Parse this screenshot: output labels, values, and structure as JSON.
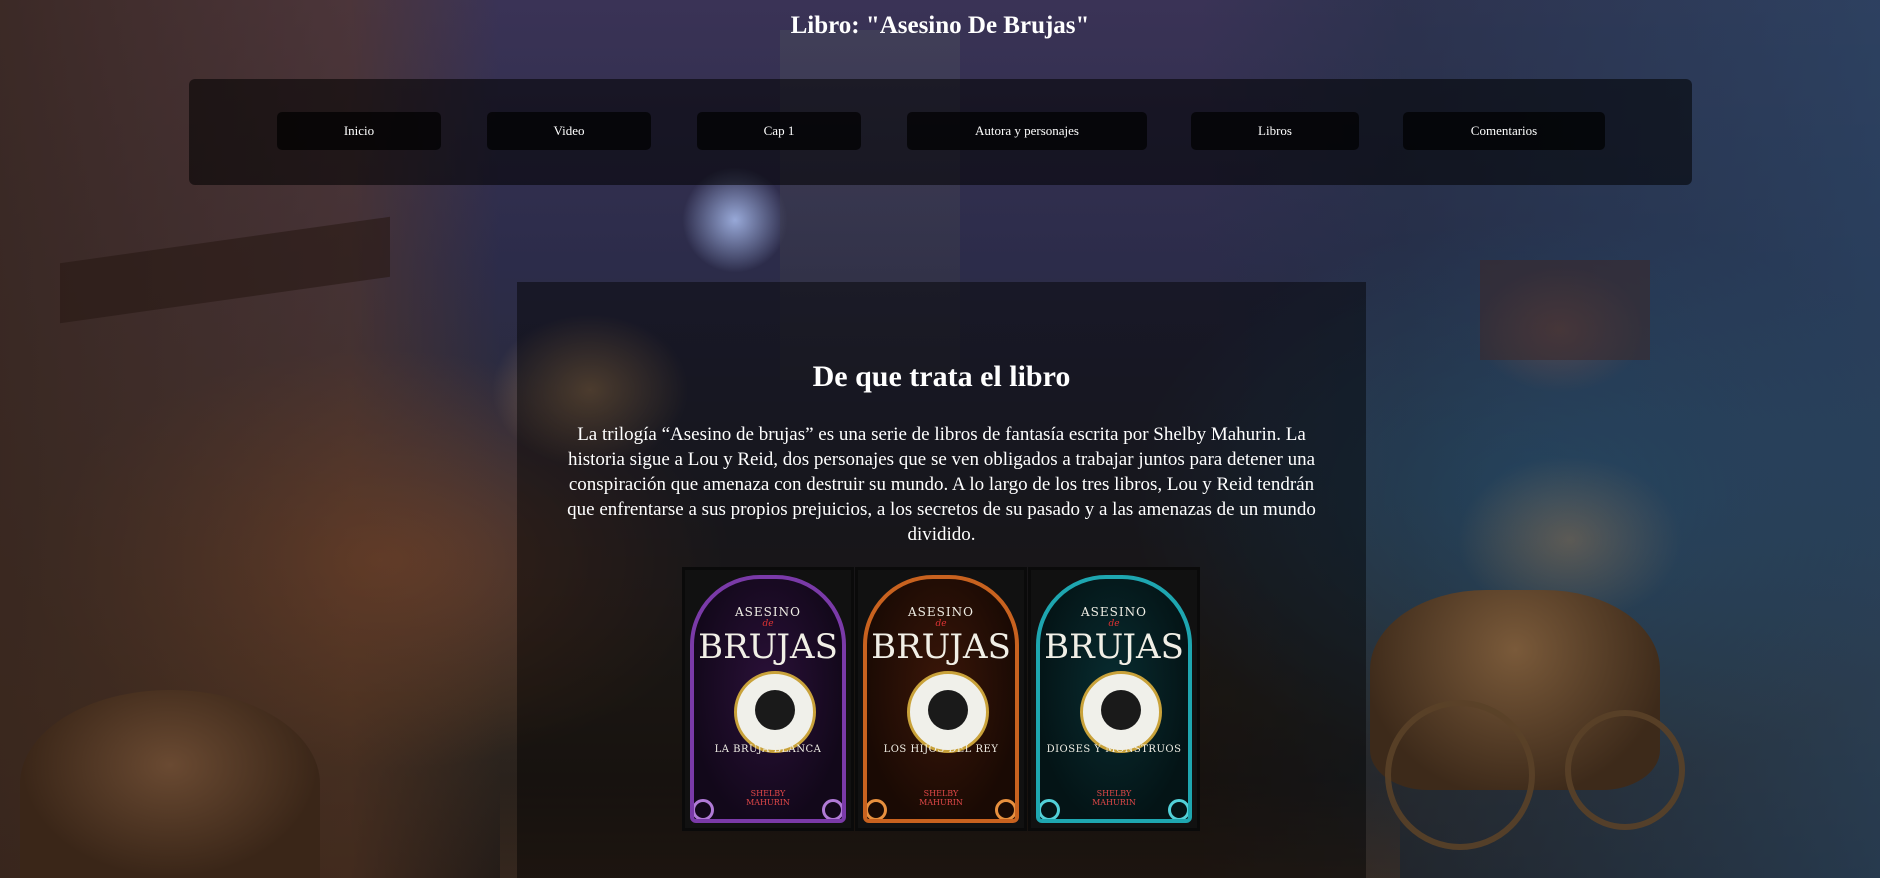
{
  "header": {
    "title": "Libro: \"Asesino De Brujas\""
  },
  "nav": {
    "items": [
      {
        "label": "Inicio"
      },
      {
        "label": "Video"
      },
      {
        "label": "Cap 1"
      },
      {
        "label": "Autora y personajes"
      },
      {
        "label": "Libros"
      },
      {
        "label": "Comentarios"
      }
    ]
  },
  "main": {
    "section_title": "De que trata el libro",
    "description": "La trilogía “Asesino de brujas” es una serie de libros de fantasía escrita por Shelby Mahurin. La historia sigue a Lou y Reid, dos personajes que se ven obligados a trabajar juntos para detener una conspiración que amenaza con destruir su mundo. A lo largo de los tres libros, Lou y Reid tendrán que enfrentarse a sus propios prejuicios, a los secretos de su pasado y a las amenazas de un mundo dividido."
  },
  "covers": [
    {
      "top": "ASESINO",
      "de": "de",
      "main": "BRUJAS",
      "subtitle": "LA BRUJA BLANCA",
      "author_first": "SHELBY",
      "author_last": "MAHURIN",
      "color": "#5a2a86",
      "accent": "#9b4fc9"
    },
    {
      "top": "ASESINO",
      "de": "de",
      "main": "BRUJAS",
      "subtitle": "LOS HIJOS DEL REY",
      "author_first": "SHELBY",
      "author_last": "MAHURIN",
      "color": "#8a3a12",
      "accent": "#d9722a"
    },
    {
      "top": "ASESINO",
      "de": "de",
      "main": "BRUJAS",
      "subtitle": "DIOSES Y MONSTRUOS",
      "author_first": "SHELBY",
      "author_last": "MAHURIN",
      "color": "#0d5f66",
      "accent": "#21b4bf"
    }
  ]
}
